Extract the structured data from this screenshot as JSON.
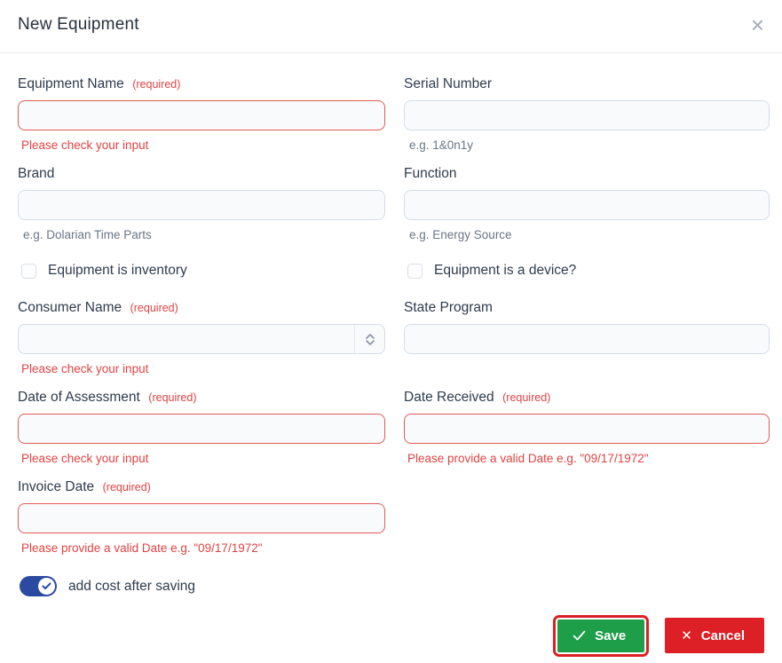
{
  "modal": {
    "title": "New Equipment",
    "close_glyph": "×"
  },
  "fields": {
    "equipment_name": {
      "label": "Equipment Name",
      "required_tag": "(required)",
      "value": "",
      "error": "Please check your input"
    },
    "serial_number": {
      "label": "Serial Number",
      "value": "",
      "hint": "e.g. 1&0n1y"
    },
    "brand": {
      "label": "Brand",
      "value": "",
      "hint": "e.g. Dolarian Time Parts"
    },
    "function": {
      "label": "Function",
      "value": "",
      "hint": "e.g. Energy Source"
    },
    "inventory_checkbox": {
      "label": "Equipment is inventory",
      "checked": false
    },
    "device_checkbox": {
      "label": "Equipment is a device?",
      "checked": false
    },
    "consumer_name": {
      "label": "Consumer Name",
      "required_tag": "(required)",
      "value": "",
      "error": "Please check your input"
    },
    "state_program": {
      "label": "State Program",
      "value": ""
    },
    "date_of_assessment": {
      "label": "Date of Assessment",
      "required_tag": "(required)",
      "value": "",
      "error": "Please check your input"
    },
    "date_received": {
      "label": "Date Received",
      "required_tag": "(required)",
      "value": "",
      "error": "Please provide a valid Date e.g. \"09/17/1972\""
    },
    "invoice_date": {
      "label": "Invoice Date",
      "required_tag": "(required)",
      "value": "",
      "error": "Please provide a valid Date e.g. \"09/17/1972\""
    },
    "add_cost_toggle": {
      "label": "add cost after saving",
      "state": "on"
    }
  },
  "footer": {
    "save_label": "Save",
    "cancel_label": "Cancel"
  },
  "colors": {
    "error_red": "#e04343",
    "error_border": "#e25a55",
    "save_green": "#1f9e4a",
    "cancel_red": "#dc2026",
    "toggle_blue": "#2b4aa2",
    "highlight_outline": "#dc2026",
    "input_background": "#f8fafc",
    "input_border": "#d5dde8",
    "label_text": "#2e3b4e"
  }
}
